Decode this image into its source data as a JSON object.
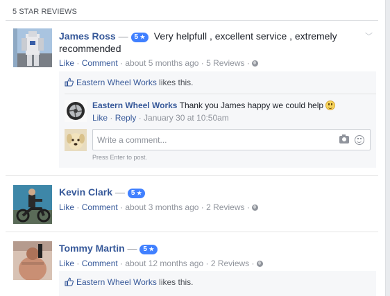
{
  "section": {
    "title": "5 STAR REVIEWS"
  },
  "reviews": [
    {
      "name": "James Ross",
      "dash": "—",
      "rating": "5",
      "text": "Very helpfull , excellent service , extremely recommended",
      "like": "Like",
      "comment": "Comment",
      "meta": "about 5 months ago",
      "count": "5 Reviews",
      "likes_page": "Eastern Wheel Works",
      "likes_suffix": "likes this.",
      "reply": {
        "author": "Eastern Wheel Works",
        "text": "Thank you James happy we could help",
        "like": "Like",
        "reply": "Reply",
        "time": "January 30 at 10:50am"
      },
      "composer": {
        "placeholder": "Write a comment...",
        "hint": "Press Enter to post."
      }
    },
    {
      "name": "Kevin Clark",
      "dash": "—",
      "rating": "5",
      "like": "Like",
      "comment": "Comment",
      "meta": "about 3 months ago",
      "count": "2 Reviews"
    },
    {
      "name": "Tommy Martin",
      "dash": "—",
      "rating": "5",
      "like": "Like",
      "comment": "Comment",
      "meta": "about 12 months ago",
      "count": "2 Reviews",
      "likes_page": "Eastern Wheel Works",
      "likes_suffix": "likes this."
    }
  ],
  "colors": {
    "link": "#365899",
    "badge": "#4080ff",
    "muted": "#90949c",
    "ufi_bg": "#f6f7f9"
  },
  "icons": [
    "thumbs-up-icon",
    "globe-icon",
    "chevron-down-icon",
    "camera-icon",
    "emoji-icon",
    "smiley-emoji-icon"
  ]
}
